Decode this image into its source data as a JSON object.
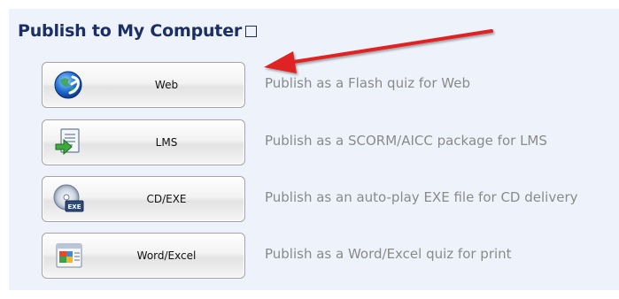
{
  "section": {
    "title": "Publish to My Computer",
    "title_suffix_glyph": "☐"
  },
  "options": [
    {
      "label": "Web",
      "description": "Publish as a Flash quiz for Web",
      "icon": "web-globe-icon"
    },
    {
      "label": "LMS",
      "description": "Publish as a SCORM/AICC package for LMS",
      "icon": "lms-package-icon"
    },
    {
      "label": "CD/EXE",
      "description": "Publish as an auto-play EXE file for CD delivery",
      "icon": "cd-exe-icon"
    },
    {
      "label": "Word/Excel",
      "description": "Publish as a Word/Excel quiz for print",
      "icon": "word-excel-icon"
    }
  ],
  "colors": {
    "panel_bg": "#eef3fb",
    "title": "#1b2f63",
    "description": "#8a8a8a",
    "arrow": "#e02020"
  }
}
